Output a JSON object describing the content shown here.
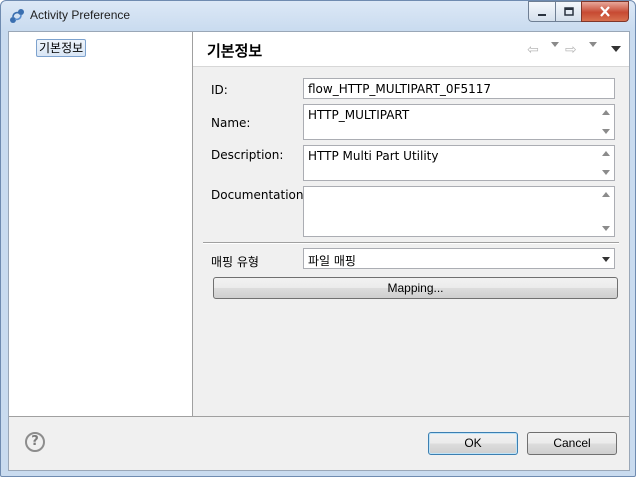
{
  "window": {
    "title": "Activity Preference"
  },
  "tree": {
    "items": [
      {
        "label": "기본정보",
        "selected": true
      }
    ]
  },
  "page": {
    "title": "기본정보"
  },
  "form": {
    "id": {
      "label": "ID:",
      "value": "flow_HTTP_MULTIPART_0F5117"
    },
    "name": {
      "label": "Name:",
      "value": "HTTP_MULTIPART"
    },
    "description": {
      "label": "Description:",
      "value": "HTTP Multi Part Utility"
    },
    "documentation": {
      "label": "Documentation:",
      "value": ""
    },
    "mapping_type": {
      "label": "매핑 유형",
      "selected": "파일 매핑"
    }
  },
  "buttons": {
    "mapping": "Mapping...",
    "ok": "OK",
    "cancel": "Cancel",
    "help": "?"
  },
  "icons": {
    "back": "back-arrow-icon",
    "forward": "forward-arrow-icon",
    "menu": "view-menu-icon",
    "help": "help-icon",
    "app": "activity-icon"
  },
  "colors": {
    "titlebar": "#c9dbef",
    "close_button": "#c74a32",
    "selection": "#d9e6f5",
    "default_button_border": "#3c7fb1"
  }
}
